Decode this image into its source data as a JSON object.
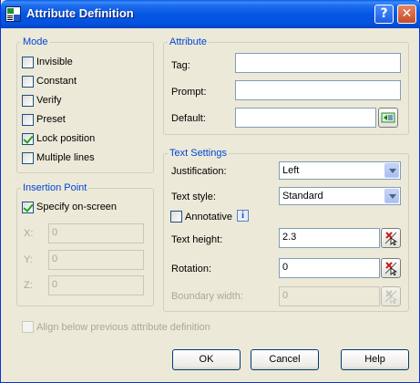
{
  "window": {
    "title": "Attribute Definition"
  },
  "mode": {
    "legend": "Mode",
    "items": [
      {
        "label": "Invisible",
        "checked": false
      },
      {
        "label": "Constant",
        "checked": false
      },
      {
        "label": "Verify",
        "checked": false
      },
      {
        "label": "Preset",
        "checked": false
      },
      {
        "label": "Lock position",
        "checked": true
      },
      {
        "label": "Multiple lines",
        "checked": false
      }
    ]
  },
  "insertion_point": {
    "legend": "Insertion Point",
    "specify_label": "Specify on-screen",
    "specify_checked": true,
    "x_label": "X:",
    "x_value": "0",
    "y_label": "Y:",
    "y_value": "0",
    "z_label": "Z:",
    "z_value": "0"
  },
  "attribute": {
    "legend": "Attribute",
    "tag_label": "Tag:",
    "tag_value": "",
    "prompt_label": "Prompt:",
    "prompt_value": "",
    "default_label": "Default:",
    "default_value": ""
  },
  "text_settings": {
    "legend": "Text Settings",
    "justification_label": "Justification:",
    "justification_value": "Left",
    "text_style_label": "Text style:",
    "text_style_value": "Standard",
    "annotative_label": "Annotative",
    "annotative_checked": false,
    "text_height_label": "Text height:",
    "text_height_value": "2.3",
    "rotation_label": "Rotation:",
    "rotation_value": "0",
    "boundary_width_label": "Boundary width:",
    "boundary_width_value": "0"
  },
  "align_below_label": "Align below previous attribute definition",
  "buttons": {
    "ok": "OK",
    "cancel": "Cancel",
    "help": "Help"
  },
  "colors": {
    "title_bar": "#0556e5",
    "legend": "#0046d5",
    "checkmark": "#21a121",
    "face": "#ece9d8"
  }
}
